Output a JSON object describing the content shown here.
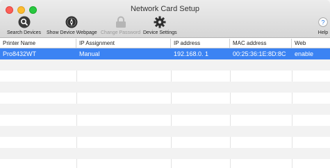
{
  "window": {
    "title": "Network Card Setup",
    "colors": {
      "selection": "#3b83f3",
      "close": "#fc5f57",
      "minimize": "#fdbc2e",
      "zoom": "#28c840"
    }
  },
  "toolbar": {
    "search_devices": {
      "label": "Search Devices",
      "icon": "magnifier-icon"
    },
    "show_webpage": {
      "label": "Show Device Webpage",
      "icon": "compass-icon"
    },
    "change_password": {
      "label": "Change Password",
      "icon": "lock-icon",
      "disabled": true
    },
    "device_settings": {
      "label": "Device Settings",
      "icon": "gear-icon"
    },
    "help": {
      "label": "Help",
      "icon": "question-icon"
    }
  },
  "table": {
    "columns": [
      "Printer Name",
      "IP Assignment",
      "IP address",
      "MAC address",
      "Web"
    ],
    "rows": [
      [
        "Pro8432WT",
        "Manual",
        "192.168.0. 1",
        "00:25:36:1E:8D:8C",
        "enable"
      ]
    ],
    "selected_row": 0
  }
}
